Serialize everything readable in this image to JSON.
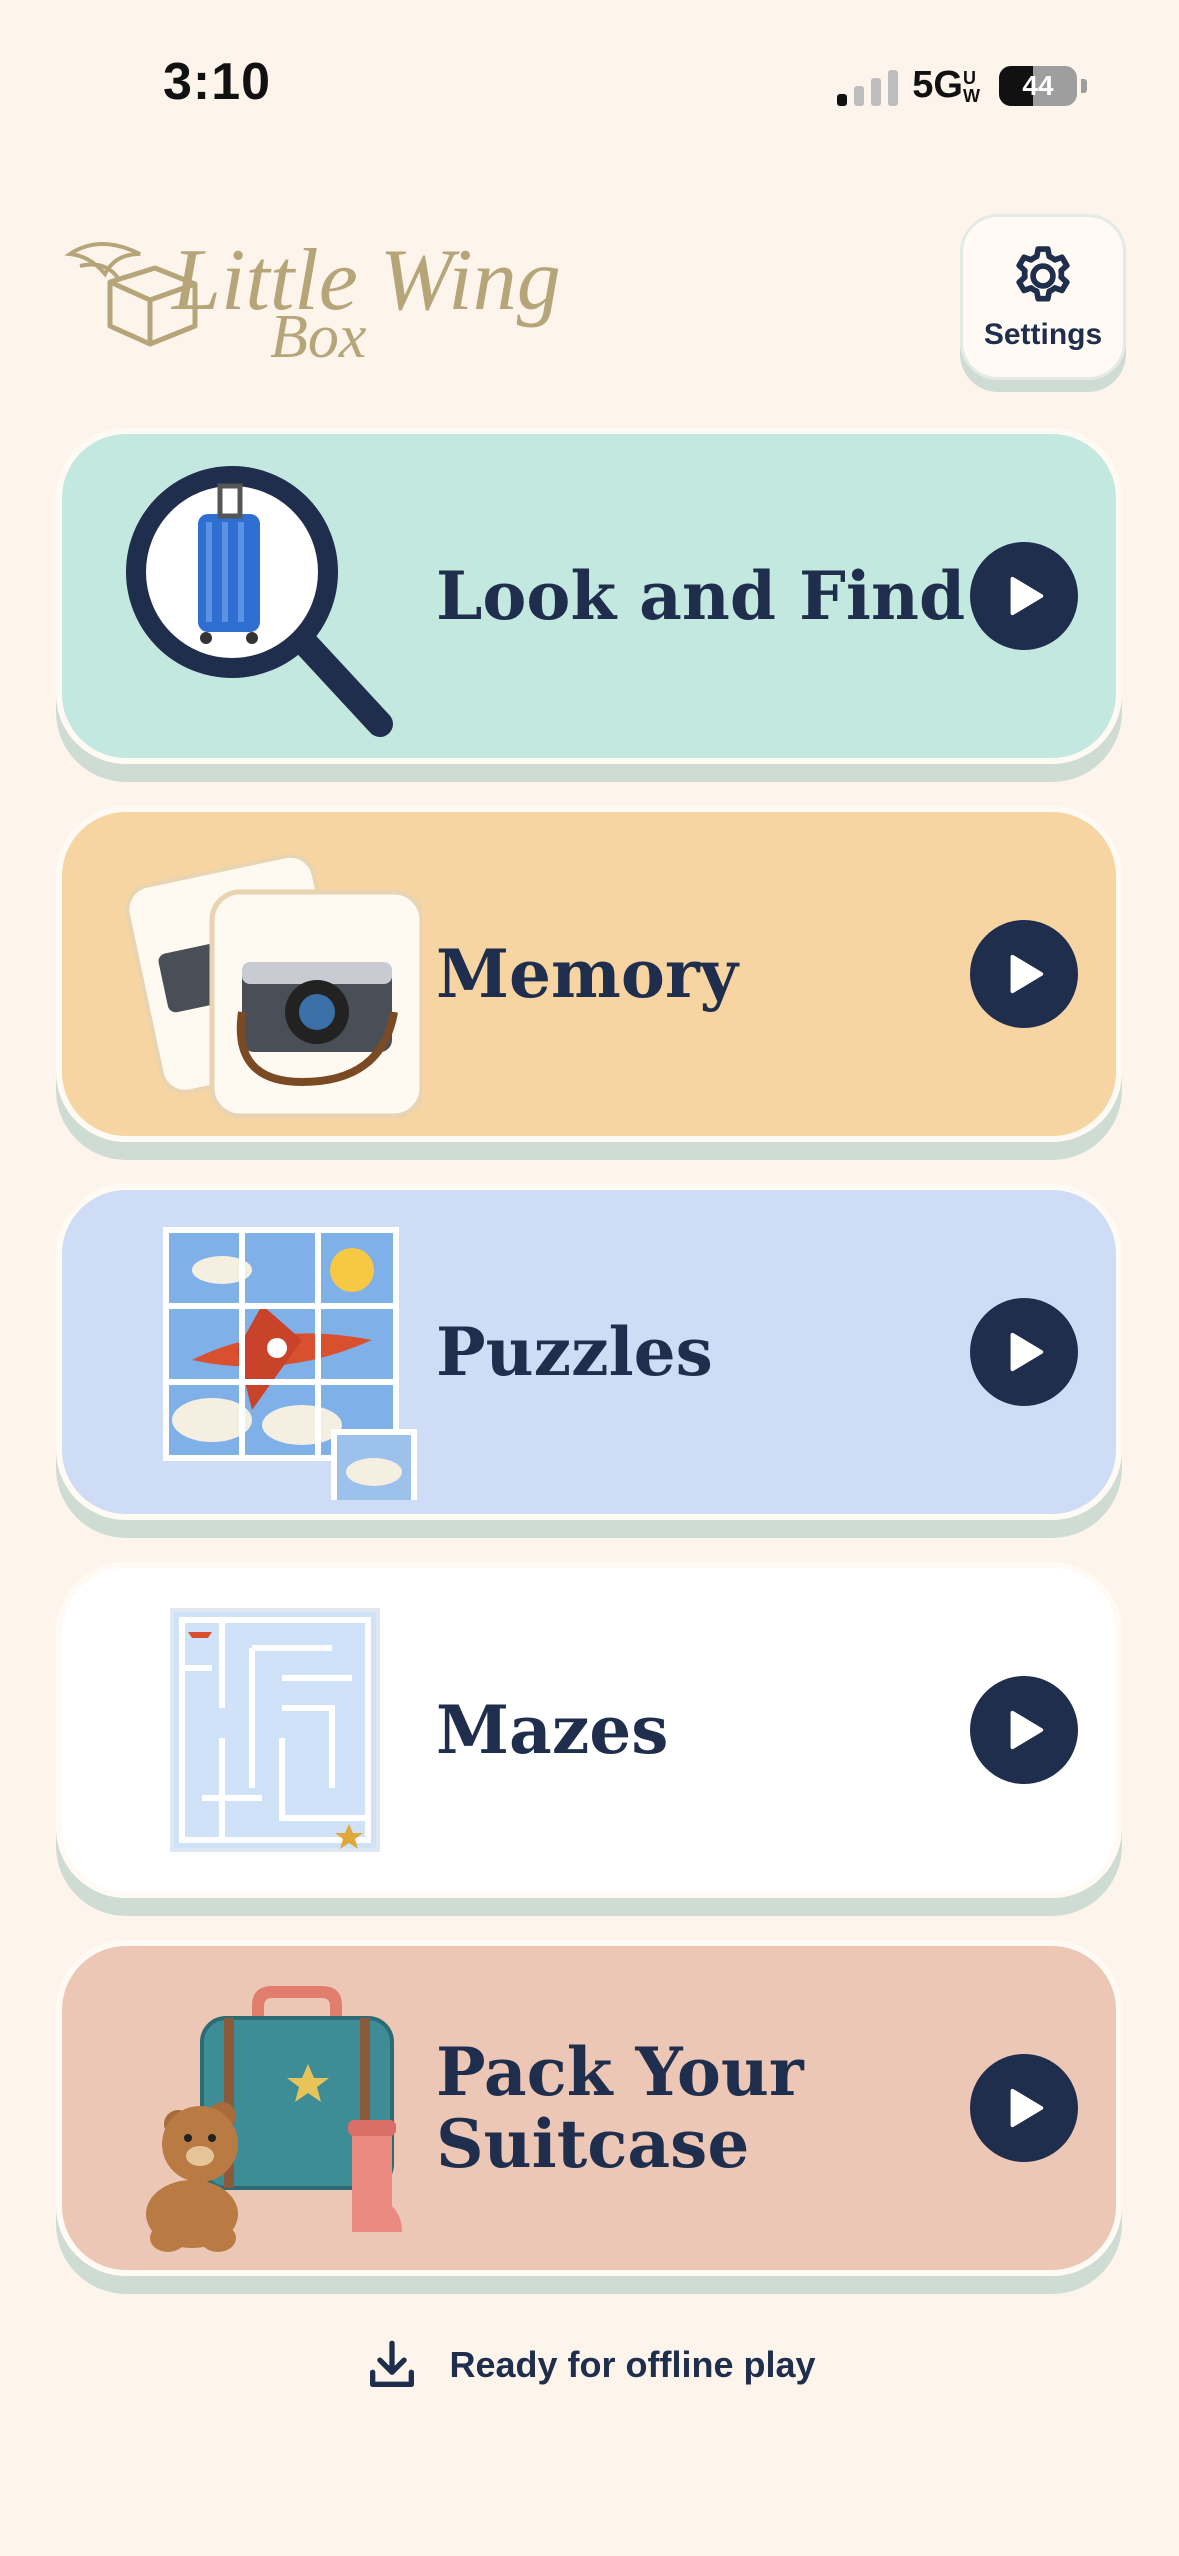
{
  "status_bar": {
    "time": "3:10",
    "network": "5G",
    "network_suffix": "UW",
    "battery_level": "44"
  },
  "header": {
    "logo_line1": "Little Wing",
    "logo_line2": "Box",
    "settings_label": "Settings",
    "settings_icon": "gear-icon"
  },
  "games": [
    {
      "title": "Look and Find",
      "color": "#c2e8df",
      "art": "magnifier-suitcase-icon"
    },
    {
      "title": "Memory",
      "color": "#f6d5a2",
      "art": "memory-cards-camera-icon"
    },
    {
      "title": "Puzzles",
      "color": "#cfdcf6",
      "art": "puzzle-airplane-icon"
    },
    {
      "title": "Mazes",
      "color": "#ffffff",
      "art": "maze-icon"
    },
    {
      "title": "Pack Your",
      "title_line2": "Suitcase",
      "color": "#ecc7b5",
      "art": "suitcase-teddy-icon"
    }
  ],
  "footer": {
    "text": "Ready for offline play",
    "icon": "download-icon"
  }
}
